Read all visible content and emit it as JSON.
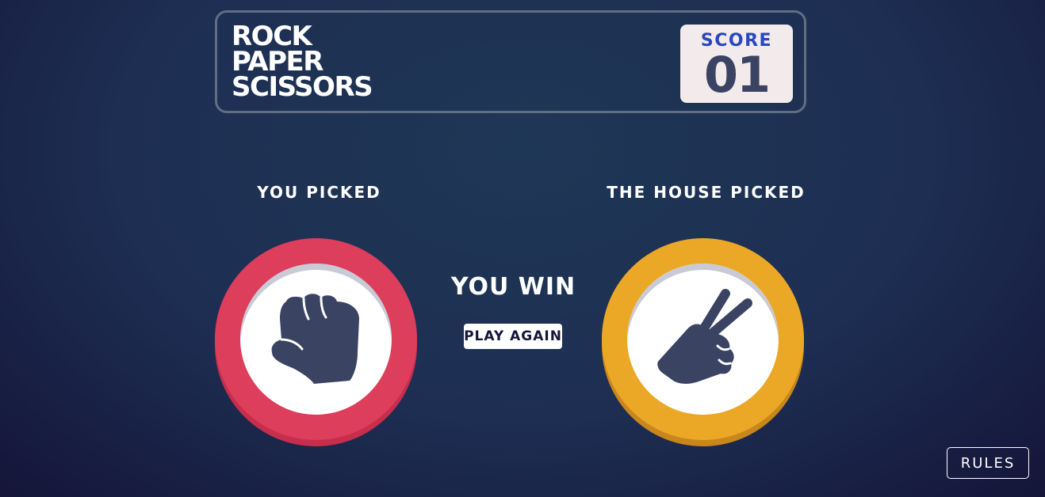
{
  "header": {
    "title_lines": [
      "Rock",
      "Paper",
      "Scissors"
    ],
    "score_label": "SCORE",
    "score_value": "01"
  },
  "player": {
    "label": "YOU PICKED",
    "choice_icon": "rock-fist-icon",
    "ring_color": "#dc3e5c"
  },
  "house": {
    "label": "THE HOUSE PICKED",
    "choice_icon": "scissors-hand-icon",
    "ring_color": "#eba826"
  },
  "result": {
    "text": "YOU WIN",
    "play_again_label": "PLAY AGAIN"
  },
  "footer": {
    "rules_label": "RULES"
  },
  "colors": {
    "background_dark": "#141539",
    "background_light": "#1f3756",
    "score_text": "#3b4363",
    "score_label": "#2a46c0"
  }
}
